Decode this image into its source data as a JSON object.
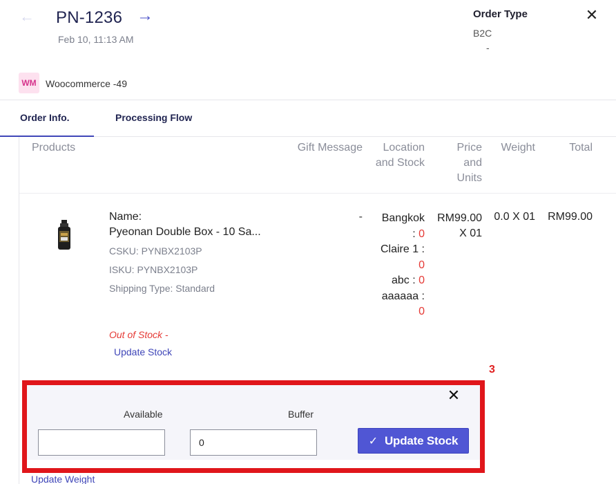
{
  "header": {
    "back_icon": "arrow-left-icon",
    "order_id": "PN-1236",
    "forward_icon": "arrow-right-icon",
    "date": "Feb 10, 11:13 AM",
    "order_type_label": "Order Type",
    "order_type_value": "B2C",
    "order_type_extra": "-",
    "close_icon": "close-icon"
  },
  "store": {
    "badge": "WM",
    "name": "Woocommerce -49"
  },
  "tabs": [
    {
      "label": "Order Info.",
      "active": true
    },
    {
      "label": "Processing Flow",
      "active": false
    }
  ],
  "table": {
    "headers": {
      "products": "Products",
      "gift": "Gift Message",
      "location_stock": "Location and Stock",
      "price_units": "Price and Units",
      "weight": "Weight",
      "total": "Total"
    },
    "row": {
      "name_label": "Name:",
      "name_value": "Pyeonan Double Box - 10 Sa...",
      "csku": "CSKU: PYNBX2103P",
      "isku": "ISKU:  PYNBX2103P",
      "shipping": "Shipping Type: Standard",
      "gift": "-",
      "locations": [
        {
          "name": "Bangkok",
          "stock": "0"
        },
        {
          "name": "Claire 1",
          "stock": "0"
        },
        {
          "name": "abc",
          "stock": "0"
        },
        {
          "name": "aaaaaa",
          "stock": "0"
        }
      ],
      "price": "RM99.00",
      "units": "X 01",
      "weight": "0.0 X 01",
      "total": "RM99.00",
      "out_of_stock": "Out of Stock -",
      "update_stock_link": "Update Stock"
    }
  },
  "annotation": {
    "number": "3"
  },
  "stock_panel": {
    "available_label": "Available",
    "available_value": "",
    "buffer_label": "Buffer",
    "buffer_value": "0",
    "submit_label": "Update Stock",
    "submit_icon": "check-icon",
    "close_icon": "close-icon"
  },
  "update_weight_link": "Update Weight",
  "colors": {
    "accent": "#5056d4",
    "link": "#3f46b8",
    "error": "#e53935",
    "annotation": "#e0161b"
  }
}
